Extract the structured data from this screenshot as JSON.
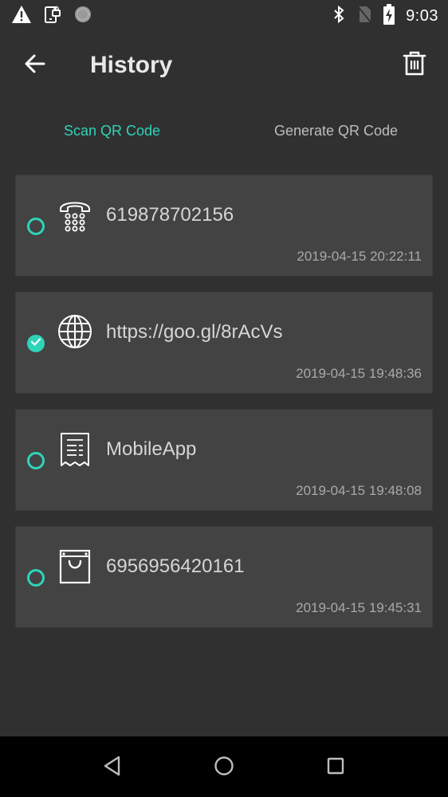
{
  "status_bar": {
    "left_icons": [
      "warning-icon",
      "device-lock-icon",
      "sync-circle-icon"
    ],
    "right_icons": [
      "bluetooth-icon",
      "no-sim-icon",
      "battery-charging-icon"
    ],
    "time": "9:03"
  },
  "app_bar": {
    "title": "History",
    "back_icon": "arrow-left-icon",
    "action_icon": "trash-icon"
  },
  "tabs": [
    {
      "label": "Scan QR Code",
      "active": true
    },
    {
      "label": "Generate QR Code",
      "active": false
    }
  ],
  "history": [
    {
      "type": "phone",
      "icon": "telephone-icon",
      "content": "619878702156",
      "timestamp": "2019-04-15 20:22:11",
      "selected": false
    },
    {
      "type": "url",
      "icon": "globe-icon",
      "content": "https://goo.gl/8rAcVs",
      "timestamp": "2019-04-15 19:48:36",
      "selected": true
    },
    {
      "type": "text",
      "icon": "receipt-icon",
      "content": "MobileApp",
      "timestamp": "2019-04-15 19:48:08",
      "selected": false
    },
    {
      "type": "product",
      "icon": "shopping-bag-icon",
      "content": "6956956420161",
      "timestamp": "2019-04-15 19:45:31",
      "selected": false
    }
  ],
  "nav_bar": [
    "back-icon",
    "home-icon",
    "recents-icon"
  ],
  "colors": {
    "accent": "#2fd3b8",
    "background": "#303030",
    "card": "#434343",
    "text_primary": "#d6d6d6",
    "text_secondary": "#a9a9a9"
  }
}
